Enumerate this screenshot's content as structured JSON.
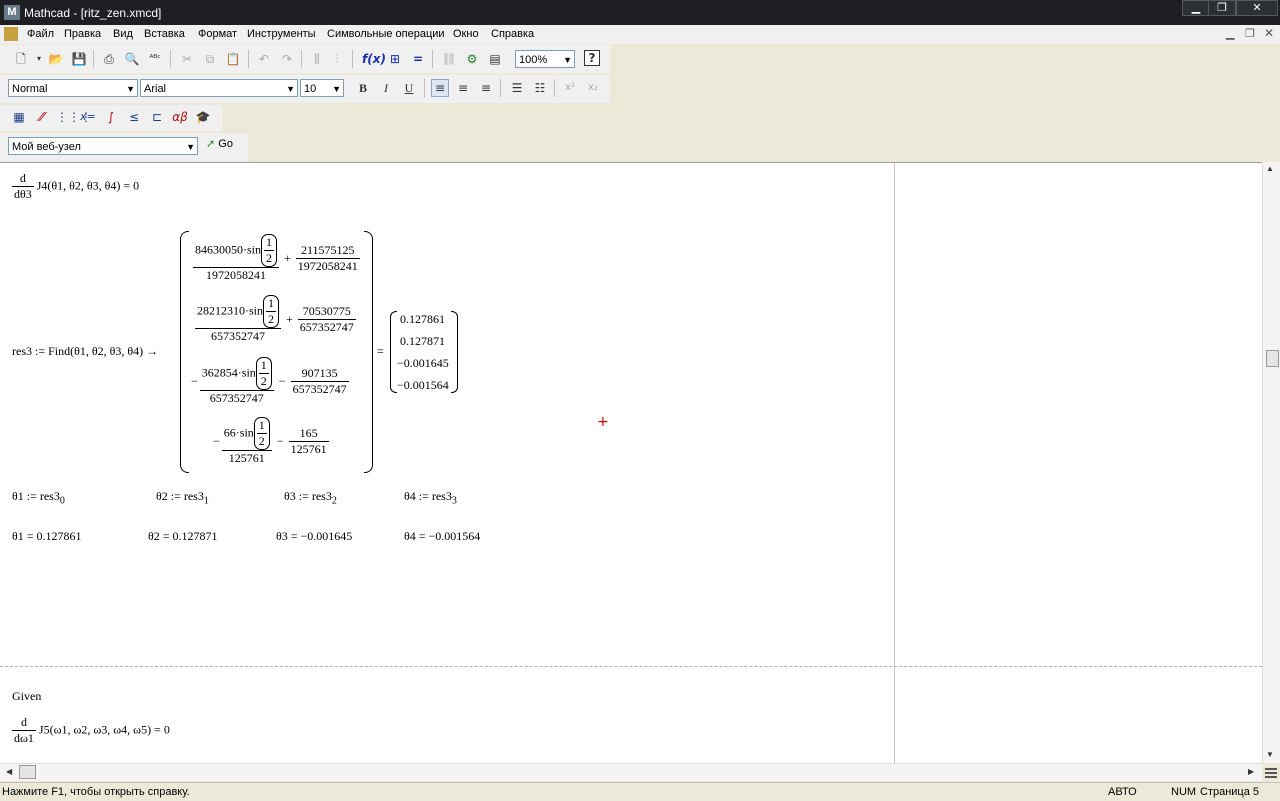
{
  "window": {
    "app_icon_letter": "M",
    "title": "Mathcad - [ritz_zen.xmcd]"
  },
  "menu": [
    "Файл",
    "Правка",
    "Вид",
    "Вставка",
    "Формат",
    "Инструменты",
    "Символьные операции",
    "Окно",
    "Справка"
  ],
  "toolbar": {
    "zoom": "100%",
    "style": "Normal",
    "font": "Arial",
    "font_size": "10",
    "bold": "B",
    "italic": "I",
    "underline": "U",
    "url_field": "Мой веб-узел",
    "go_label": "Go",
    "help_glyph": "?"
  },
  "math": {
    "deriv1_num": "d",
    "deriv1_den": "dθ3",
    "deriv1_expr": "J4(θ1, θ2, θ3, θ4) = 0",
    "res3_lhs": "res3 := Find(θ1, θ2, θ3, θ4) →",
    "sym": [
      {
        "sign": "",
        "a_num": "84630050·sin",
        "half_num": "1",
        "half_den": "2",
        "a_den": "1972058241",
        "op": "+",
        "b_num": "211575125",
        "b_den": "1972058241"
      },
      {
        "sign": "",
        "a_num": "28212310·sin",
        "half_num": "1",
        "half_den": "2",
        "a_den": "657352747",
        "op": "+",
        "b_num": "70530775",
        "b_den": "657352747"
      },
      {
        "sign": "−",
        "a_num": "362854·sin",
        "half_num": "1",
        "half_den": "2",
        "a_den": "657352747",
        "op": "−",
        "b_num": "907135",
        "b_den": "657352747"
      },
      {
        "sign": "−",
        "a_num": "66·sin",
        "half_num": "1",
        "half_den": "2",
        "a_den": "125761",
        "op": "−",
        "b_num": "165",
        "b_den": "125761"
      }
    ],
    "equals": "=",
    "numeric": [
      "0.127861",
      "0.127871",
      "−0.001645",
      "−0.001564"
    ],
    "assigns": [
      {
        "lhs": "θ1 := res3",
        "sub": "0"
      },
      {
        "lhs": "θ2 := res3",
        "sub": "1"
      },
      {
        "lhs": "θ3 := res3",
        "sub": "2"
      },
      {
        "lhs": "θ4 := res3",
        "sub": "3"
      }
    ],
    "results": [
      "θ1 = 0.127861",
      "θ2 = 0.127871",
      "θ3 = −0.001645",
      "θ4 = −0.001564"
    ],
    "given": "Given",
    "deriv2_num": "d",
    "deriv2_den": "dω1",
    "deriv2_expr": "J5(ω1, ω2, ω3, ω4, ω5) = 0"
  },
  "status": {
    "hint": "Нажмите F1, чтобы открыть справку.",
    "mode": "АВТО",
    "num": "NUM",
    "page": "Страница 5"
  }
}
